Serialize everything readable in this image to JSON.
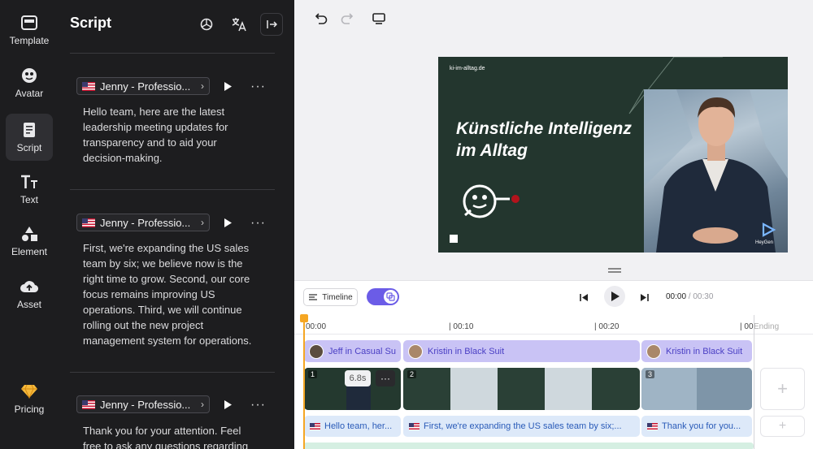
{
  "rail": {
    "items": [
      {
        "label": "Template",
        "icon": "template-icon"
      },
      {
        "label": "Avatar",
        "icon": "avatar-icon"
      },
      {
        "label": "Script",
        "icon": "script-icon",
        "active": true
      },
      {
        "label": "Text",
        "icon": "text-icon"
      },
      {
        "label": "Element",
        "icon": "element-icon"
      },
      {
        "label": "Asset",
        "icon": "asset-upload-icon"
      }
    ],
    "pricing": {
      "label": "Pricing",
      "icon": "diamond-icon"
    }
  },
  "script_panel": {
    "title": "Script",
    "blocks": [
      {
        "voice": "Jenny - Professio...",
        "text": "Hello team, here are the latest leadership meeting updates for transparency and to aid your decision-making."
      },
      {
        "voice": "Jenny - Professio...",
        "text": "First, we're expanding the US sales team by six; we believe now is the right time to grow. Second, our core focus remains improving US operations. Third, we will continue rolling out the new project management system for operations."
      },
      {
        "voice": "Jenny - Professio...",
        "text": "Thank you for your attention. Feel free to ask any questions regarding these"
      }
    ]
  },
  "slide": {
    "url": "ki-im-alltag.de",
    "title_line1": "Künstliche Intelligenz",
    "title_line2": "im Alltag",
    "logo": "HeyGen"
  },
  "timeline": {
    "timeline_label": "Timeline",
    "current_time": "00:00",
    "duration": " / 00:30",
    "ticks": [
      "00:00",
      "| 00:10",
      "| 00:20",
      "| 00"
    ],
    "ending_label": "Ending",
    "avatar_clips": [
      "Jeff in Casual Su",
      "Kristin in Black Suit",
      "Kristin in Black Suit"
    ],
    "scene_numbers": [
      "1",
      "2",
      "3"
    ],
    "scene_duration": "6.8s",
    "script_clips": [
      "Hello team, her...",
      "First, we're expanding the US sales team by six;...",
      "Thank you for you..."
    ]
  },
  "colors": {
    "accent": "#6b5ce7",
    "avatar_clip": "#c9c3f5",
    "script_clip": "#dde9f9",
    "playhead": "#f5a623",
    "slide_bg": "#23362e",
    "panel_bg": "#1d1d1f"
  }
}
